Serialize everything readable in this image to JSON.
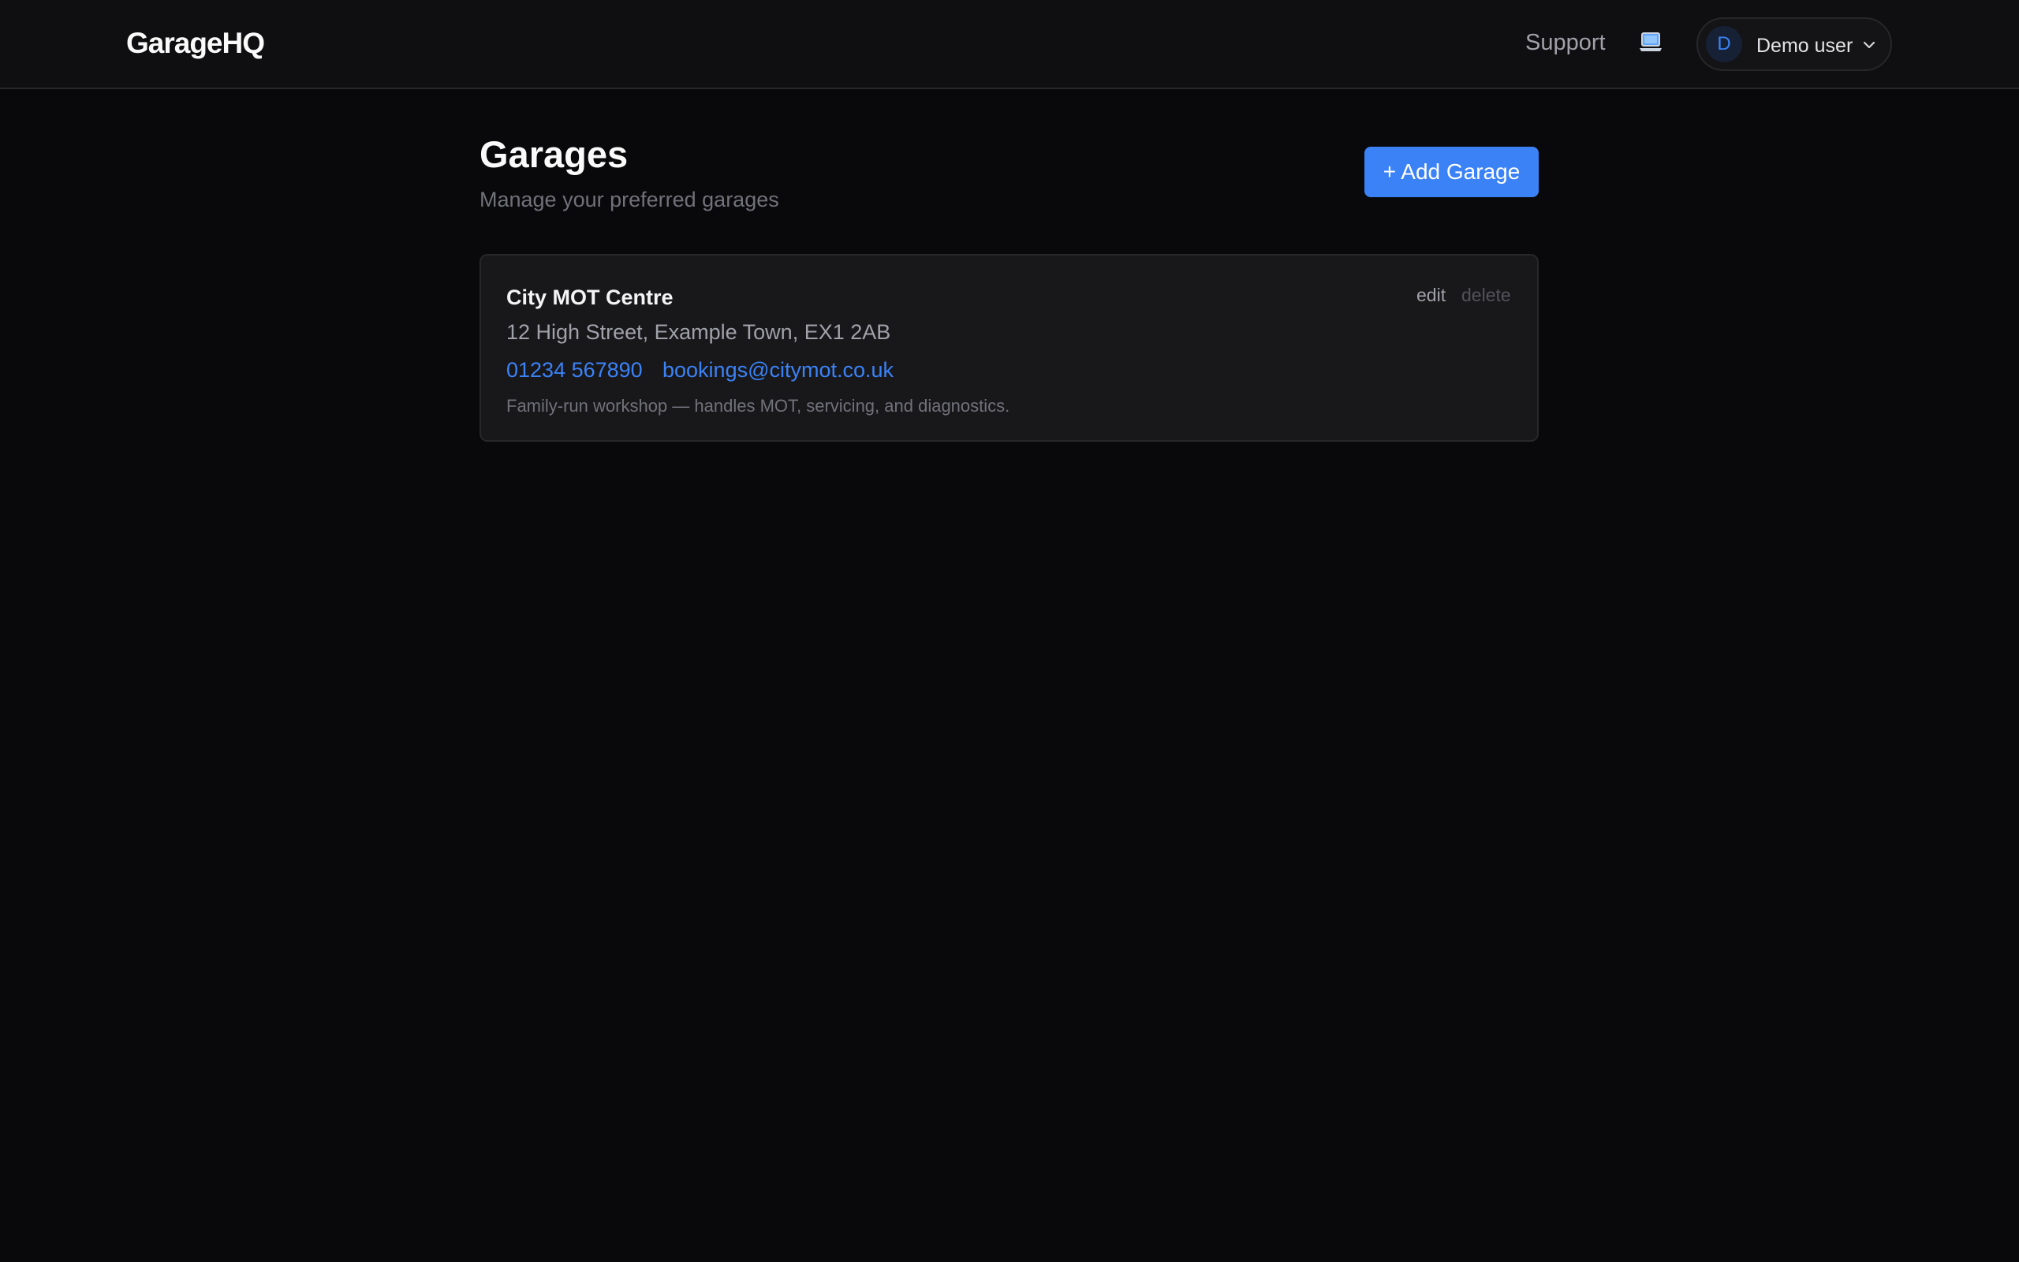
{
  "header": {
    "brand": "GarageHQ",
    "support_label": "Support",
    "device_icon": "laptop-icon",
    "user": {
      "initial": "D",
      "name": "Demo user",
      "menu_icon": "chevron-down-icon"
    }
  },
  "main": {
    "title": "Garages",
    "subtitle": "Manage your preferred garages",
    "add_button_label": "+ Add Garage",
    "garages": [
      {
        "name": "City MOT Centre",
        "address": "12 High Street, Example Town, EX1 2AB",
        "phone": "01234 567890",
        "email": "bookings@citymot.co.uk",
        "notes": "Family-run workshop — handles MOT, servicing, and diagnostics.",
        "edit_label": "edit",
        "delete_label": "delete"
      }
    ]
  },
  "colors": {
    "background": "#09090b",
    "header": "#0f0f11",
    "card": "#18181b",
    "accent": "#3b82f6",
    "border": "#27272a"
  }
}
